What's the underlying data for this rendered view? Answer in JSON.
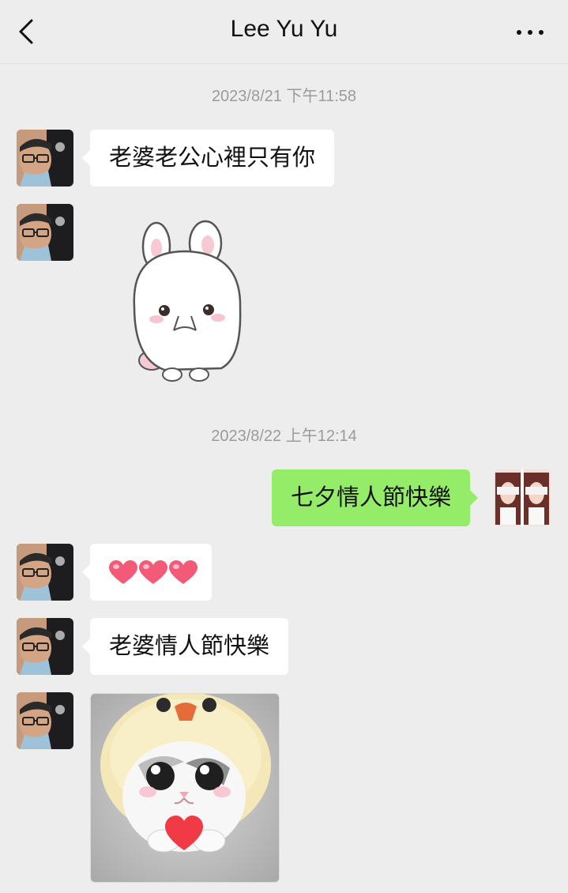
{
  "header": {
    "title": "Lee Yu Yu",
    "back_icon": "chevron-left-icon",
    "more_icon": "more-dots-icon"
  },
  "colors": {
    "background": "#ededed",
    "incoming_bubble": "#ffffff",
    "outgoing_bubble": "#95ec69",
    "timestamp_text": "#9b9b9b"
  },
  "messages": {
    "ts1": "2023/8/21 下午11:58",
    "m1": "老婆老公心裡只有你",
    "m2_sticker": "white-bunny-sticker",
    "ts2": "2023/8/22 上午12:14",
    "m3": "七夕情人節快樂",
    "m4_emoji": "three-hearts-emoji",
    "m5": "老婆情人節快樂",
    "m6_image": "kitten-in-chick-hat-holding-heart"
  }
}
